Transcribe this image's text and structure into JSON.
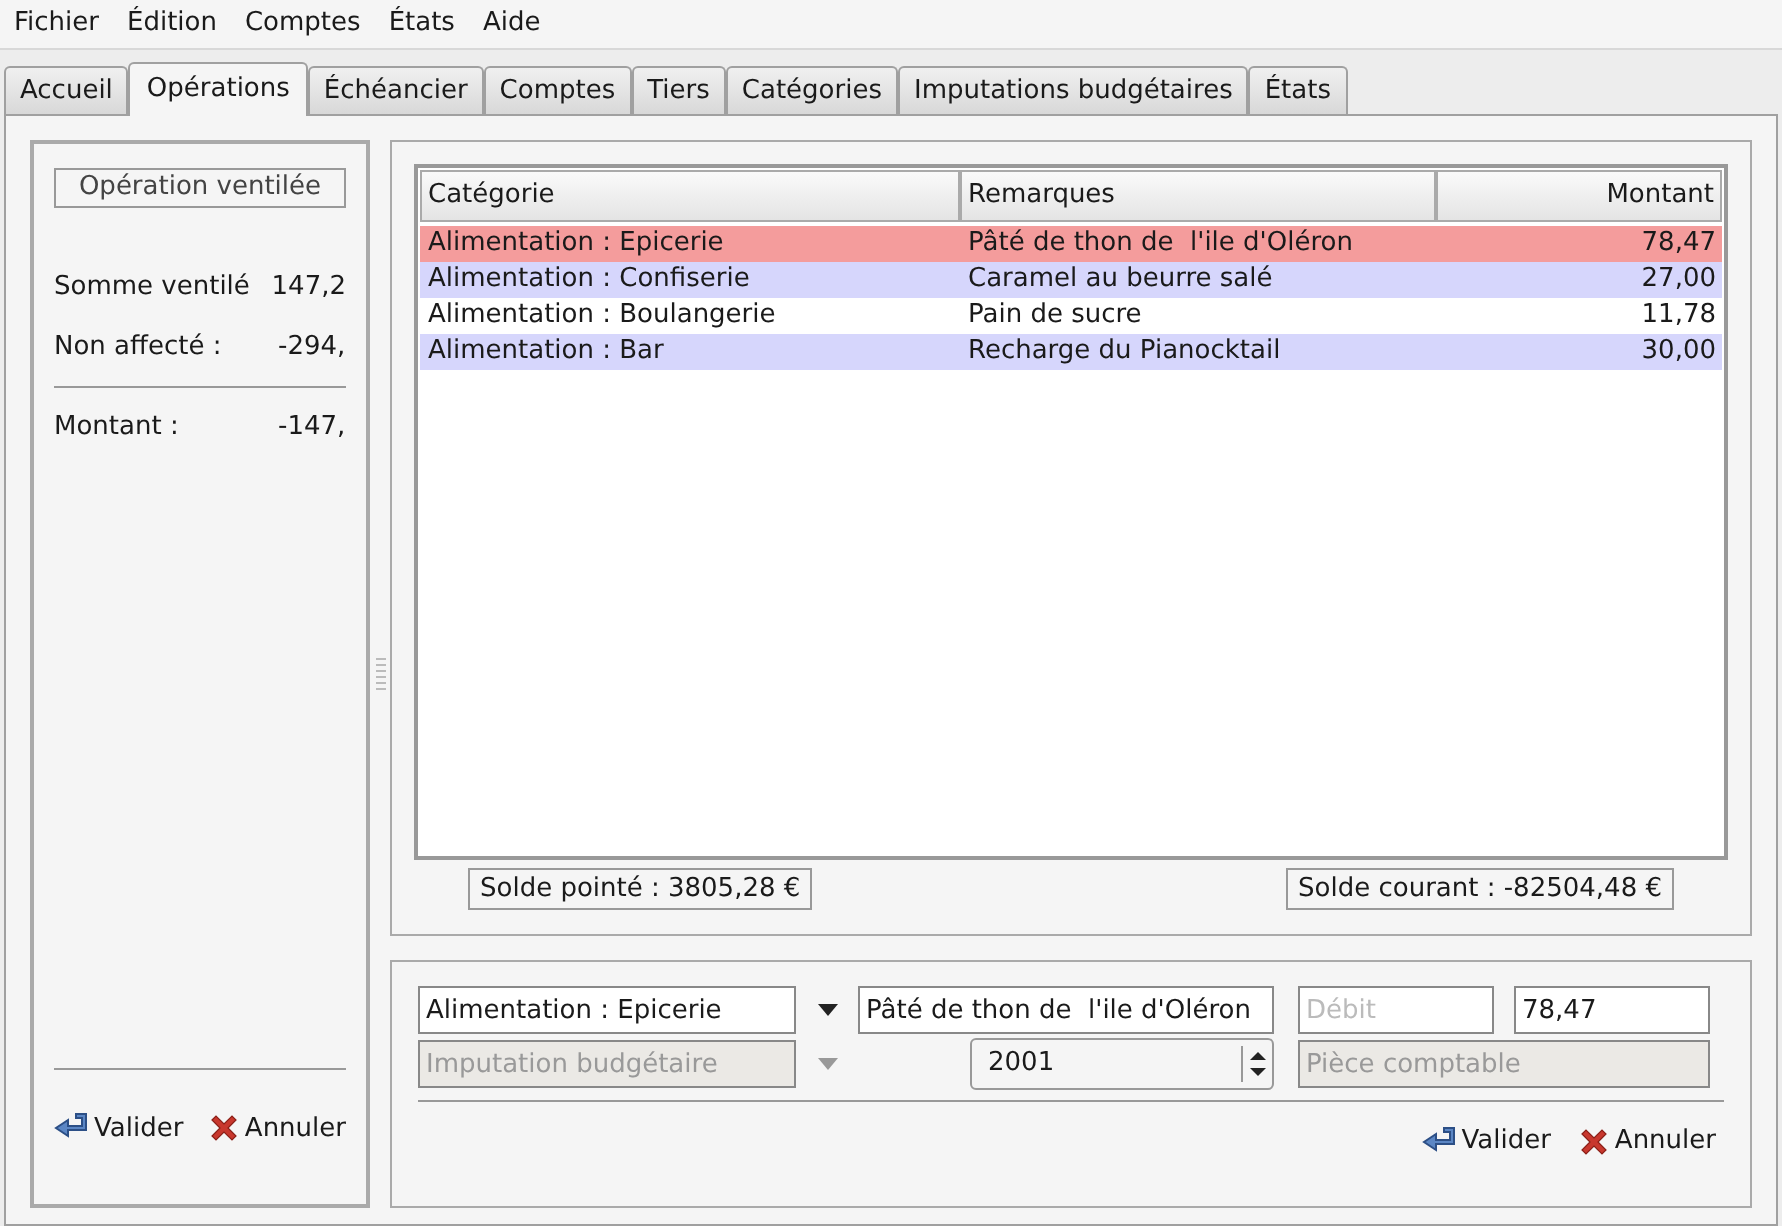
{
  "menu": [
    "Fichier",
    "Édition",
    "Comptes",
    "États",
    "Aide"
  ],
  "tabs": [
    {
      "label": "Accueil",
      "selected": false
    },
    {
      "label": "Opérations",
      "selected": true
    },
    {
      "label": "Échéancier",
      "selected": false
    },
    {
      "label": "Comptes",
      "selected": false
    },
    {
      "label": "Tiers",
      "selected": false
    },
    {
      "label": "Catégories",
      "selected": false
    },
    {
      "label": "Imputations budgétaires",
      "selected": false
    },
    {
      "label": "États",
      "selected": false
    }
  ],
  "left_panel": {
    "title_button": "Opération ventilée",
    "summary": [
      {
        "label": "Somme ventilé",
        "value": "147,2"
      },
      {
        "label": "Non affecté :",
        "value": "-294,"
      }
    ],
    "total": {
      "label": "Montant :",
      "value": "-147,"
    },
    "buttons": [
      {
        "kind": "validate",
        "label": "Valider"
      },
      {
        "kind": "cancel",
        "label": "Annuler"
      }
    ]
  },
  "table": {
    "columns": [
      "Catégorie",
      "Remarques",
      "Montant"
    ],
    "rows": [
      {
        "category": "Alimentation : Epicerie",
        "remark": "Pâté de thon de  l'ile d'Oléron",
        "amount": "78,47",
        "selected": true
      },
      {
        "category": "Alimentation : Confiserie",
        "remark": "Caramel au beurre salé",
        "amount": "27,00",
        "selected": false
      },
      {
        "category": "Alimentation : Boulangerie",
        "remark": "Pain de sucre",
        "amount": "11,78",
        "selected": false
      },
      {
        "category": "Alimentation : Bar",
        "remark": "Recharge du Pianocktail",
        "amount": "30,00",
        "selected": false
      }
    ]
  },
  "balances": {
    "cleared": "Solde pointé : 3805,28 €",
    "current": "Solde courant : -82504,48 €"
  },
  "form": {
    "category": {
      "value": "Alimentation : Epicerie",
      "disabled": false
    },
    "remark": {
      "value": "Pâté de thon de  l'ile d'Oléron"
    },
    "debit": {
      "placeholder": "Débit"
    },
    "credit": {
      "value": "78,47"
    },
    "budget": {
      "placeholder": "Imputation budgétaire",
      "disabled": true
    },
    "year": {
      "value": "2001"
    },
    "voucher": {
      "placeholder": "Pièce comptable",
      "disabled": true
    },
    "buttons": [
      {
        "kind": "validate",
        "label": "Valider"
      },
      {
        "kind": "cancel",
        "label": "Annuler"
      }
    ]
  }
}
